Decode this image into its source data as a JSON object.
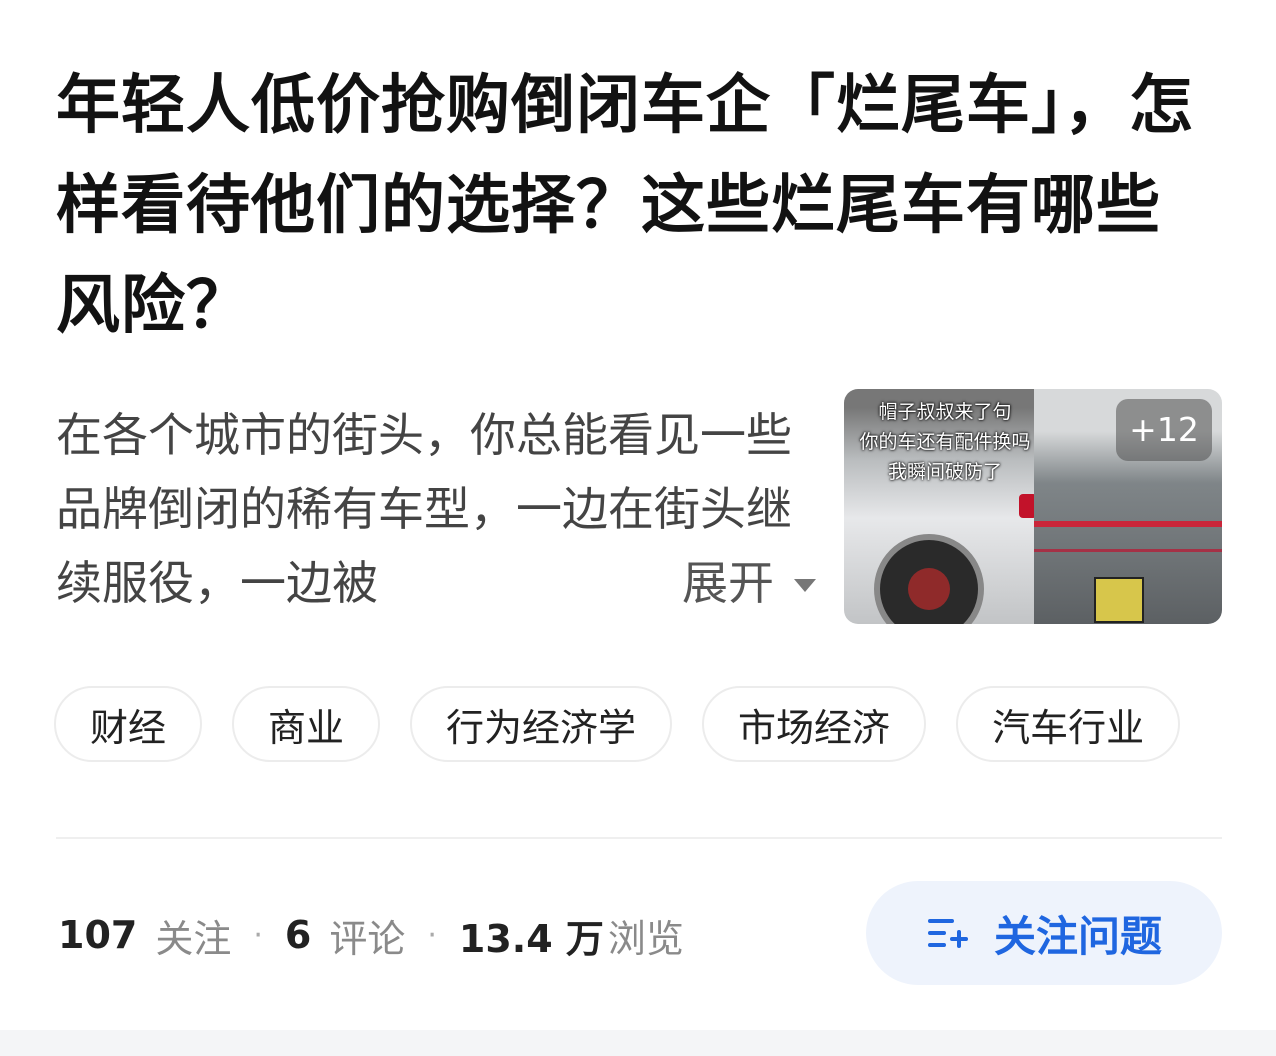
{
  "question": {
    "title": "年轻人低价抢购倒闭车企「烂尾车」，怎样看待他们的选择？这些烂尾车有哪些风险？",
    "excerpt": "在各个城市的街头，你总能看见一些品牌倒闭的稀有车型，一边在街头继续服役，一边被",
    "expand_label": "展开"
  },
  "thumbnail": {
    "caption_lines": [
      "帽子叔叔来了句",
      "你的车还有配件换吗",
      "我瞬间破防了"
    ],
    "more_count": "+12"
  },
  "tags": [
    "财经",
    "商业",
    "行为经济学",
    "市场经济",
    "汽车行业"
  ],
  "stats": {
    "followers_count": "107",
    "followers_label": "关注",
    "comments_count": "6",
    "comments_label": "评论",
    "views_count": "13.4 万",
    "views_label": "浏览",
    "separator": "·"
  },
  "follow_button": {
    "label": "关注问题",
    "icon": "add-list-icon",
    "color": "#1f66e0"
  }
}
